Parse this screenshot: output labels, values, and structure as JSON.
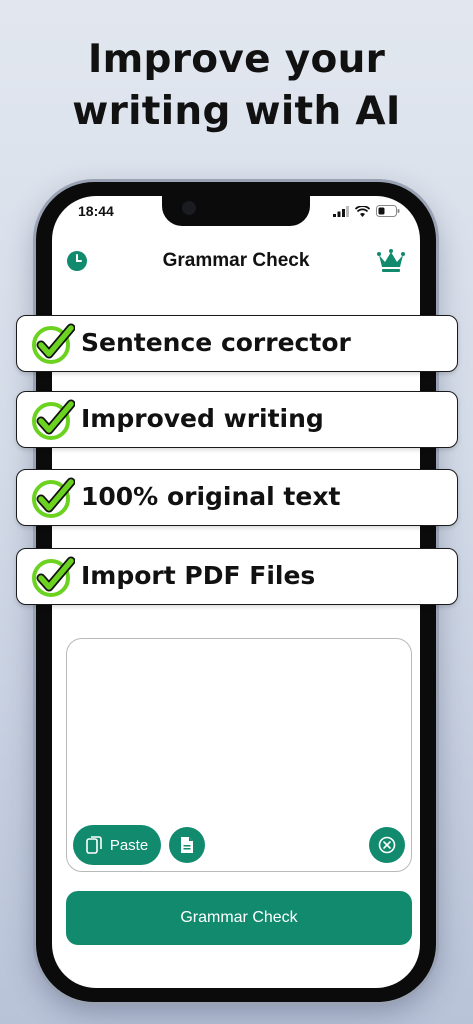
{
  "headline": {
    "line1": "Improve your",
    "line2": "writing with AI"
  },
  "status_bar": {
    "time": "18:44"
  },
  "app": {
    "title": "Grammar Check",
    "paste_label": "Paste",
    "check_button_label": "Grammar Check",
    "accent_color": "#118a6e"
  },
  "features": [
    {
      "label": "Sentence corrector",
      "icon": "green-check-icon"
    },
    {
      "label": "Improved writing",
      "icon": "green-check-icon"
    },
    {
      "label": "100% original text",
      "icon": "green-check-icon"
    },
    {
      "label": "Import PDF Files",
      "icon": "green-check-icon"
    }
  ],
  "check_color": "#6bd21f"
}
